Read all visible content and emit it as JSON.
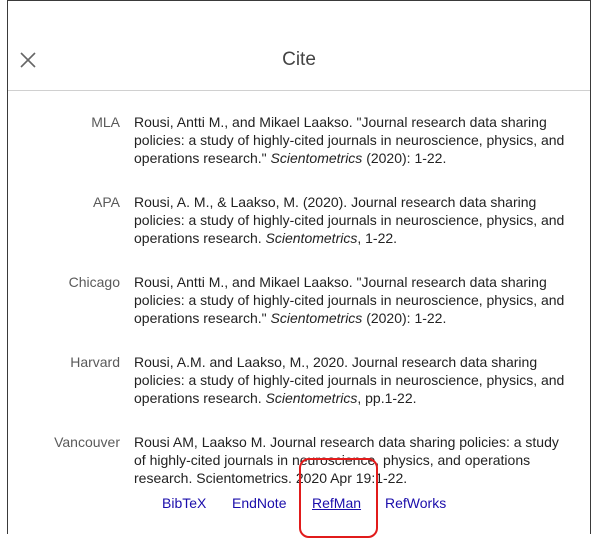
{
  "dialog": {
    "title": "Cite",
    "close_label": "×"
  },
  "citations": [
    {
      "style": "MLA",
      "text_before": "Rousi, Antti M., and Mikael Laakso. \"Journal research data sharing policies: a study of highly-cited journals in neuroscience, physics, and operations research.\" ",
      "journal": "Scientometrics",
      "text_after": " (2020): 1-22."
    },
    {
      "style": "APA",
      "text_before": "Rousi, A. M., & Laakso, M. (2020). Journal research data sharing policies: a study of highly-cited journals in neuroscience, physics, and operations research. ",
      "journal": "Scientometrics",
      "text_after": ", 1-22."
    },
    {
      "style": "Chicago",
      "text_before": "Rousi, Antti M., and Mikael Laakso. \"Journal research data sharing policies: a study of highly-cited journals in neuroscience, physics, and operations research.\" ",
      "journal": "Scientometrics",
      "text_after": " (2020): 1-22."
    },
    {
      "style": "Harvard",
      "text_before": "Rousi, A.M. and Laakso, M., 2020. Journal research data sharing policies: a study of highly-cited journals in neuroscience, physics, and operations research. ",
      "journal": "Scientometrics",
      "text_after": ", pp.1-22."
    },
    {
      "style": "Vancouver",
      "text_before": "Rousi AM, Laakso M. Journal research data sharing policies: a study of highly-cited journals in neuroscience, physics, and operations research. Scientometrics. 2020 Apr 19:1-22.",
      "journal": "",
      "text_after": ""
    }
  ],
  "export_links": {
    "bibtex": "BibTeX",
    "endnote": "EndNote",
    "refman": "RefMan",
    "refworks": "RefWorks"
  },
  "colors": {
    "link": "#1a0dab",
    "highlight": "#e11b1b"
  }
}
